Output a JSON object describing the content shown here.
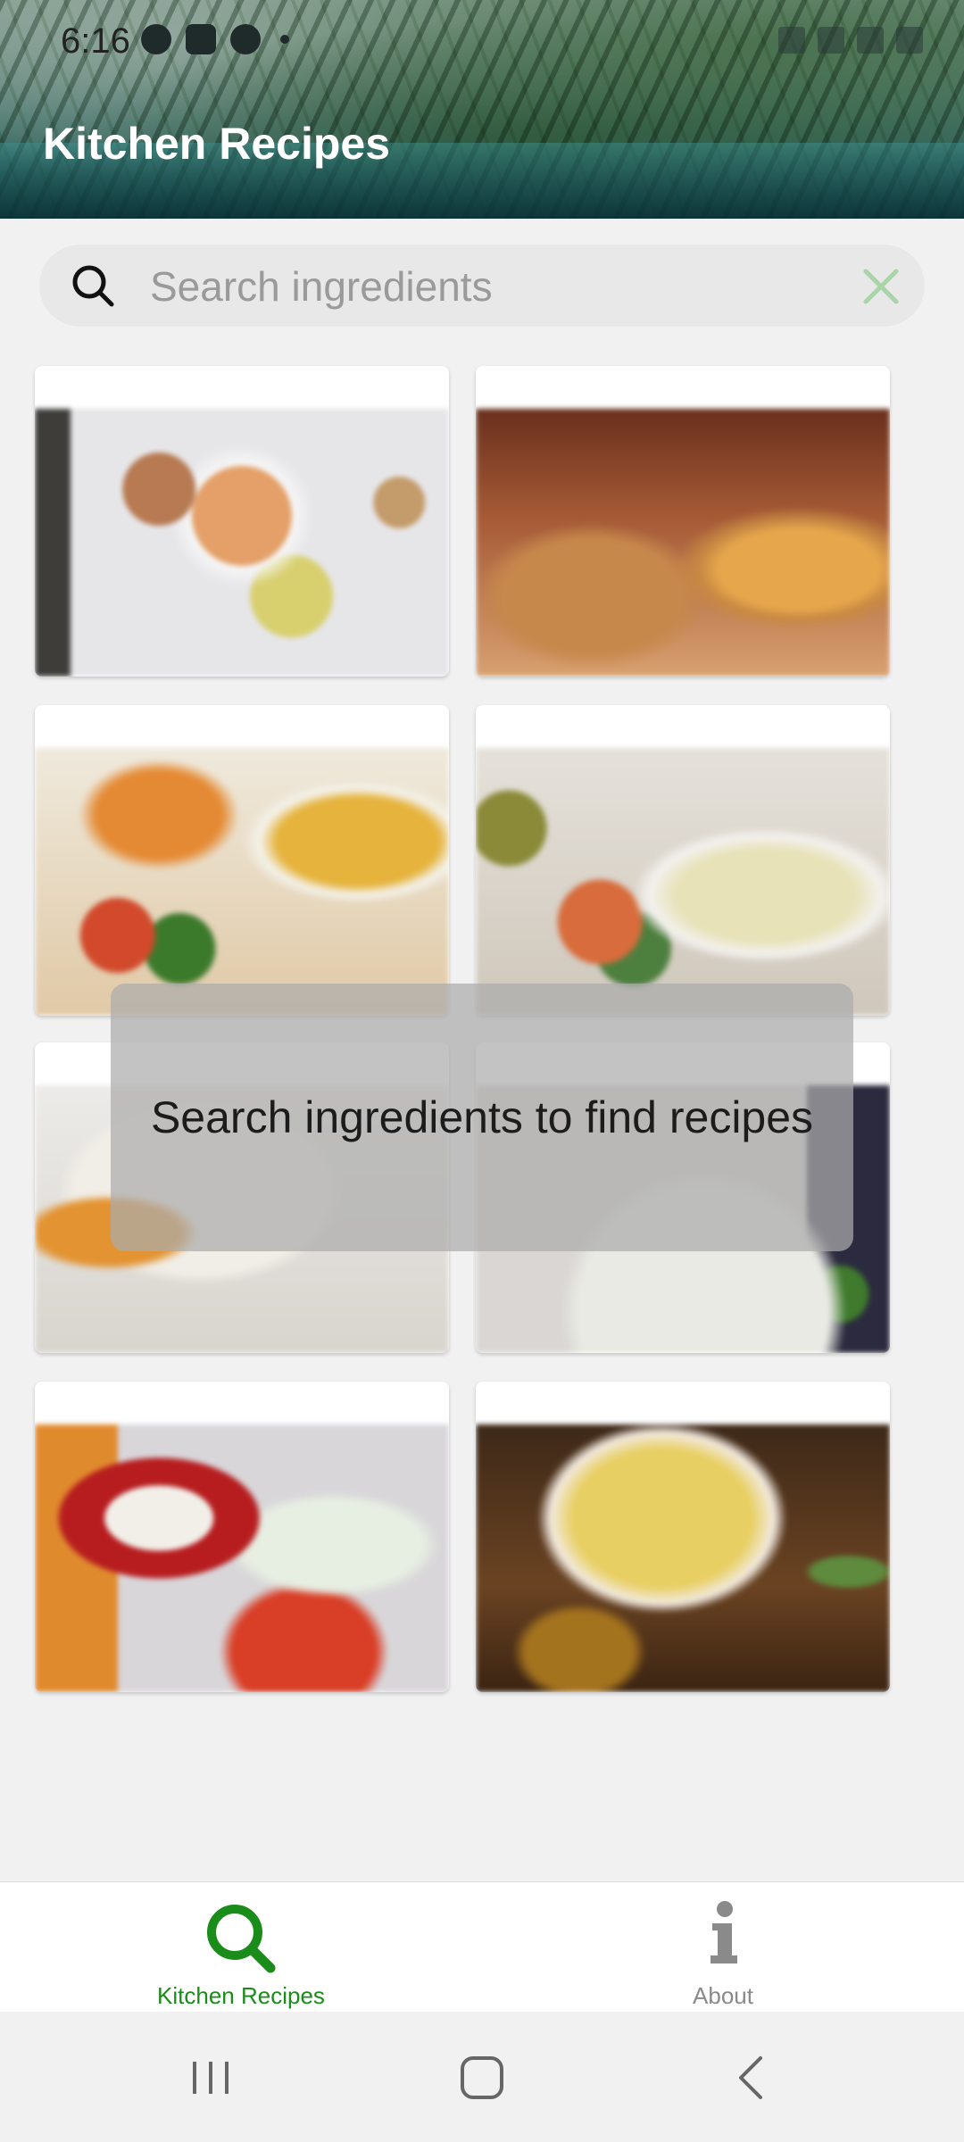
{
  "status_bar": {
    "time": "6:16",
    "left_icons": [
      "threads-icon",
      "discord-icon",
      "chrome-icon",
      "dot-icon"
    ],
    "right_icons": [
      "mute-icon",
      "wifi-icon",
      "signal-icon",
      "battery-icon"
    ]
  },
  "header": {
    "title": "Kitchen Recipes"
  },
  "search": {
    "placeholder": "Search ingredients",
    "value": ""
  },
  "recipes": [
    {
      "image": "food-photo-1"
    },
    {
      "image": "food-photo-2"
    },
    {
      "image": "food-photo-3"
    },
    {
      "image": "food-photo-4"
    },
    {
      "image": "food-photo-5"
    },
    {
      "image": "food-photo-6"
    },
    {
      "image": "food-photo-7"
    },
    {
      "image": "food-photo-8"
    }
  ],
  "toast": {
    "message": "Search ingredients to find recipes"
  },
  "bottom_nav": {
    "items": [
      {
        "label": "Kitchen Recipes",
        "icon": "search-icon",
        "active": true
      },
      {
        "label": "About",
        "icon": "info-icon",
        "active": false
      }
    ]
  },
  "colors": {
    "accent": "#1a8c1a",
    "inactive": "#8a8a8a",
    "clear_icon": "#a8d4a8"
  },
  "system_nav": [
    "recents-button",
    "home-button",
    "back-button"
  ]
}
